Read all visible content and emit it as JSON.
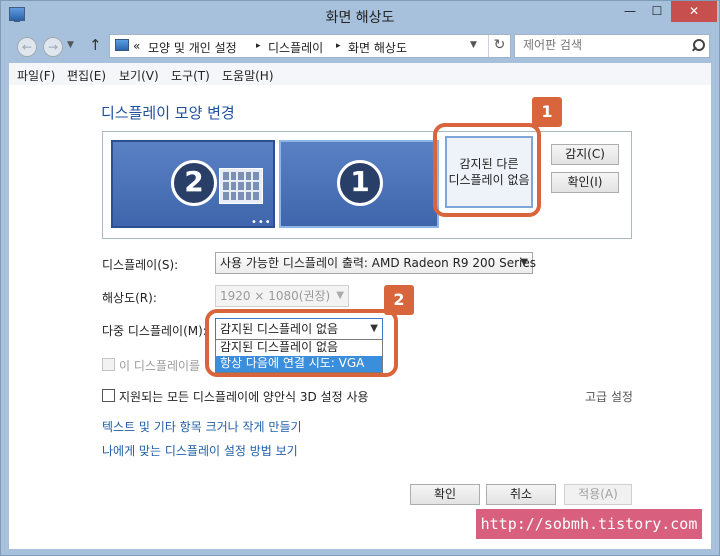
{
  "window": {
    "title": "화면 해상도",
    "minimize": "—",
    "maximize": "☐",
    "close": "✕"
  },
  "address": {
    "back_icon": "back-arrow-icon",
    "prefix": "«",
    "crumbs": [
      "모양 및 개인 설정",
      "디스플레이",
      "화면 해상도"
    ],
    "separator": "▸",
    "refresh": "↻"
  },
  "search": {
    "placeholder": "제어판 검색"
  },
  "menu": [
    "파일(F)",
    "편집(E)",
    "보기(V)",
    "도구(T)",
    "도움말(H)"
  ],
  "main": {
    "heading": "디스플레이 모양 변경",
    "monitors": [
      {
        "number": "2"
      },
      {
        "number": "1"
      }
    ],
    "monitor_dots": "•••",
    "undetected_line1": "감지된 다른",
    "undetected_line2": "디스플레이 없음",
    "detect_button": "감지(C)",
    "identify_button": "확인(I)"
  },
  "settings": {
    "display_label": "디스플레이(S):",
    "display_value": "사용 가능한 디스플레이 출력: AMD Radeon R9 200 Series",
    "resolution_label": "해상도(R):",
    "resolution_value": "1920 × 1080(권장)",
    "multi_label": "다중 디스플레이(M):",
    "multi_value": "감지된 디스플레이 없음",
    "multi_options": [
      "감지된 디스플레이 없음",
      "항상 다음에 연결 시도: VGA"
    ],
    "multi_selected_index": 1,
    "main_display_checkbox": "이 디스플레이를",
    "stereo_checkbox": "지원되는 모든 디스플레이에 양안식 3D 설정 사용",
    "advanced_link": "고급 설정"
  },
  "links": {
    "text_size": "텍스트 및 기타 항목 크거나 작게 만들기",
    "help": "나에게 맞는 디스플레이 설정 방법 보기"
  },
  "footer": {
    "ok": "확인",
    "cancel": "취소",
    "apply": "적용(A)"
  },
  "annotations": {
    "badge1": "1",
    "badge2": "2"
  },
  "watermark": "http://sobmh.tistory.com",
  "colors": {
    "accent": "#d9653c",
    "link": "#1f5ea8",
    "heading": "#1f4fa0",
    "selection": "#3a8edc",
    "watermark_bg": "#d8607e"
  }
}
